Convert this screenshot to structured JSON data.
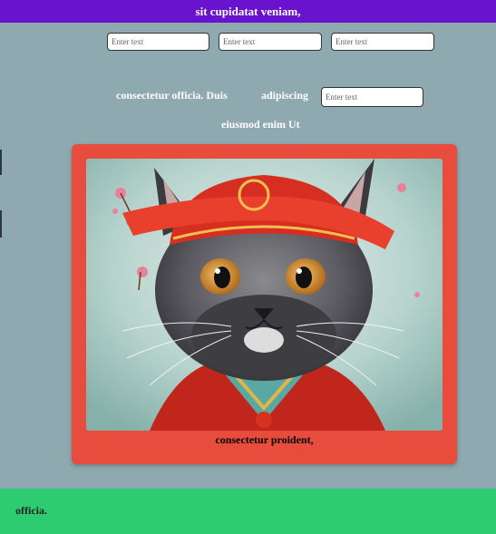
{
  "header": {
    "title": "sit cupidatat veniam,"
  },
  "form": {
    "field1": {
      "placeholder": "Enter text"
    },
    "field2": {
      "placeholder": "Enter text"
    },
    "field3": {
      "placeholder": "Enter text"
    },
    "label_line1": "consectetur officia. Duis",
    "label_adipiscing": "adipiscing",
    "field4": {
      "placeholder": "Enter text"
    },
    "label_line2": "eiusmod enim Ut"
  },
  "card": {
    "image_icon": "cat-portrait-image",
    "caption": "consectetur proident,",
    "bg_color": "#e74c3c"
  },
  "footer": {
    "text": "officia.",
    "bg_color": "#2ecc71"
  },
  "colors": {
    "header": "#6a13cf",
    "page_bg": "#8fa9b0"
  }
}
